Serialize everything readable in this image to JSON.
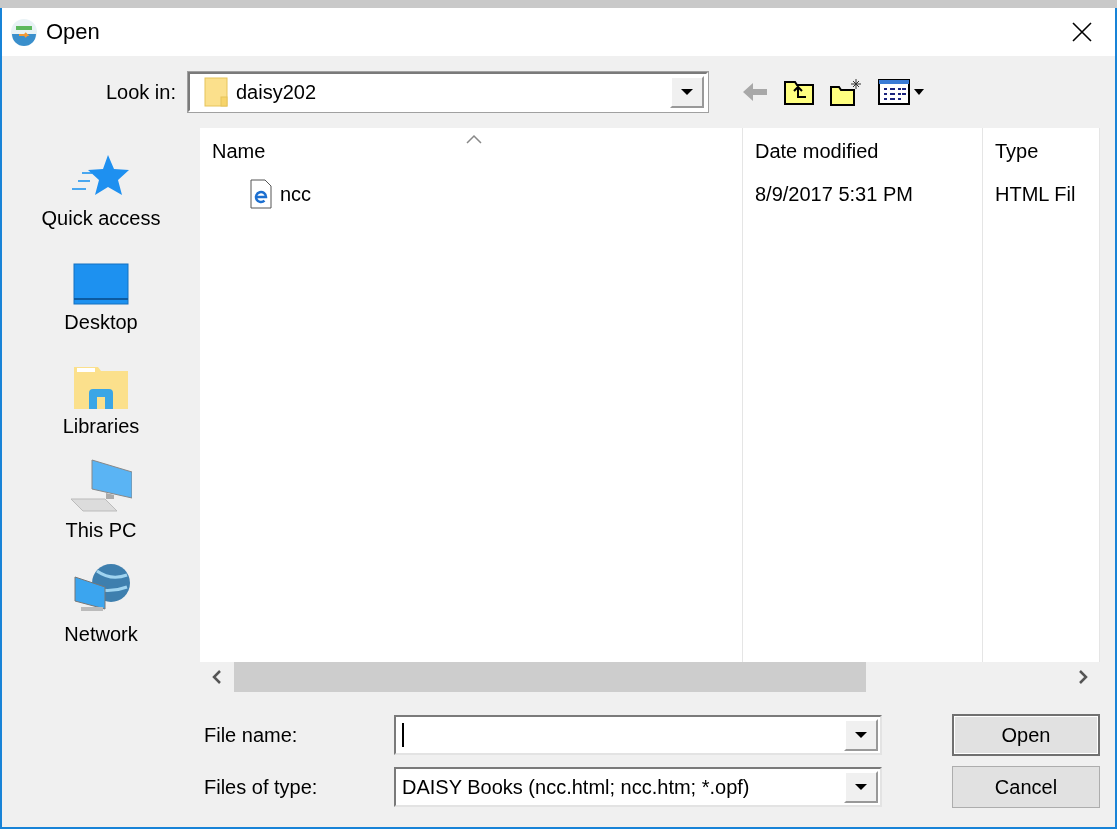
{
  "window": {
    "title": "Open"
  },
  "look_in": {
    "label": "Look in:",
    "value": "daisy202"
  },
  "places": [
    {
      "label": "Quick access",
      "kind": "star"
    },
    {
      "label": "Desktop",
      "kind": "desktop"
    },
    {
      "label": "Libraries",
      "kind": "libraries"
    },
    {
      "label": "This PC",
      "kind": "pc"
    },
    {
      "label": "Network",
      "kind": "network"
    }
  ],
  "file_list": {
    "columns": [
      "Name",
      "Date modified",
      "Type"
    ],
    "rows": [
      {
        "name": "ncc",
        "date_modified": "8/9/2017 5:31 PM",
        "type": "HTML Fil"
      }
    ]
  },
  "file_name": {
    "label": "File name:"
  },
  "files_of_type": {
    "label": "Files of type:",
    "value": "DAISY Books (ncc.html; ncc.htm; *.opf)"
  },
  "buttons": [
    {
      "label": "Open",
      "default": true
    },
    {
      "label": "Cancel",
      "default": false
    }
  ]
}
